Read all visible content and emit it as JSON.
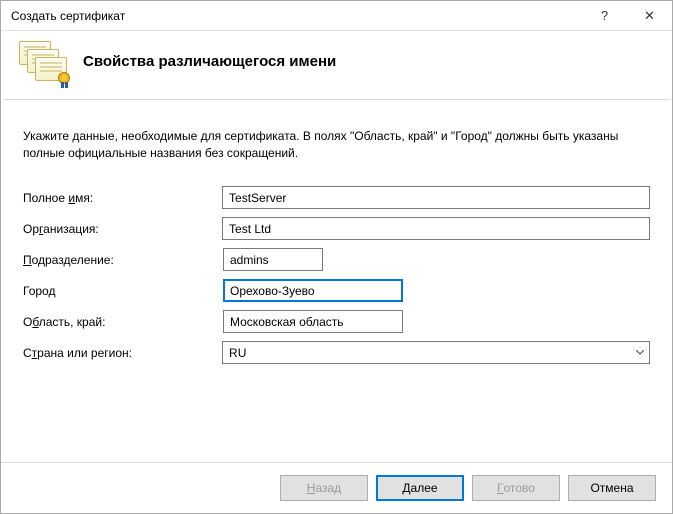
{
  "window": {
    "title": "Создать сертификат",
    "help_symbol": "?",
    "close_symbol": "✕"
  },
  "header": {
    "heading": "Свойства различающегося имени"
  },
  "instructions": "Укажите данные, необходимые для сертификата. В полях \"Область, край\" и \"Город\" должны быть указаны полные официальные названия без сокращений.",
  "fields": {
    "common_name": {
      "label_pre": "Полное ",
      "label_u": "и",
      "label_post": "мя:",
      "value": "TestServer"
    },
    "organization": {
      "label_pre": "Ор",
      "label_u": "г",
      "label_post": "анизация:",
      "value": "Test Ltd"
    },
    "ou": {
      "label_pre": "",
      "label_u": "П",
      "label_post": "одразделение:",
      "value": "admins"
    },
    "city": {
      "label_pre": "Горо",
      "label_u": "д",
      "label_post": "",
      "value": "Орехово-Зуево"
    },
    "state": {
      "label_pre": "О",
      "label_u": "б",
      "label_post": "ласть, край:",
      "value": "Московская область"
    },
    "country": {
      "label_pre": "С",
      "label_u": "т",
      "label_post": "рана или регион:",
      "value": "RU"
    }
  },
  "buttons": {
    "back": {
      "pre": "",
      "u": "Н",
      "post": "азад"
    },
    "next": {
      "pre": "",
      "u": "Д",
      "post": "алее"
    },
    "finish": {
      "pre": "",
      "u": "Г",
      "post": "отово"
    },
    "cancel": "Отмена"
  }
}
